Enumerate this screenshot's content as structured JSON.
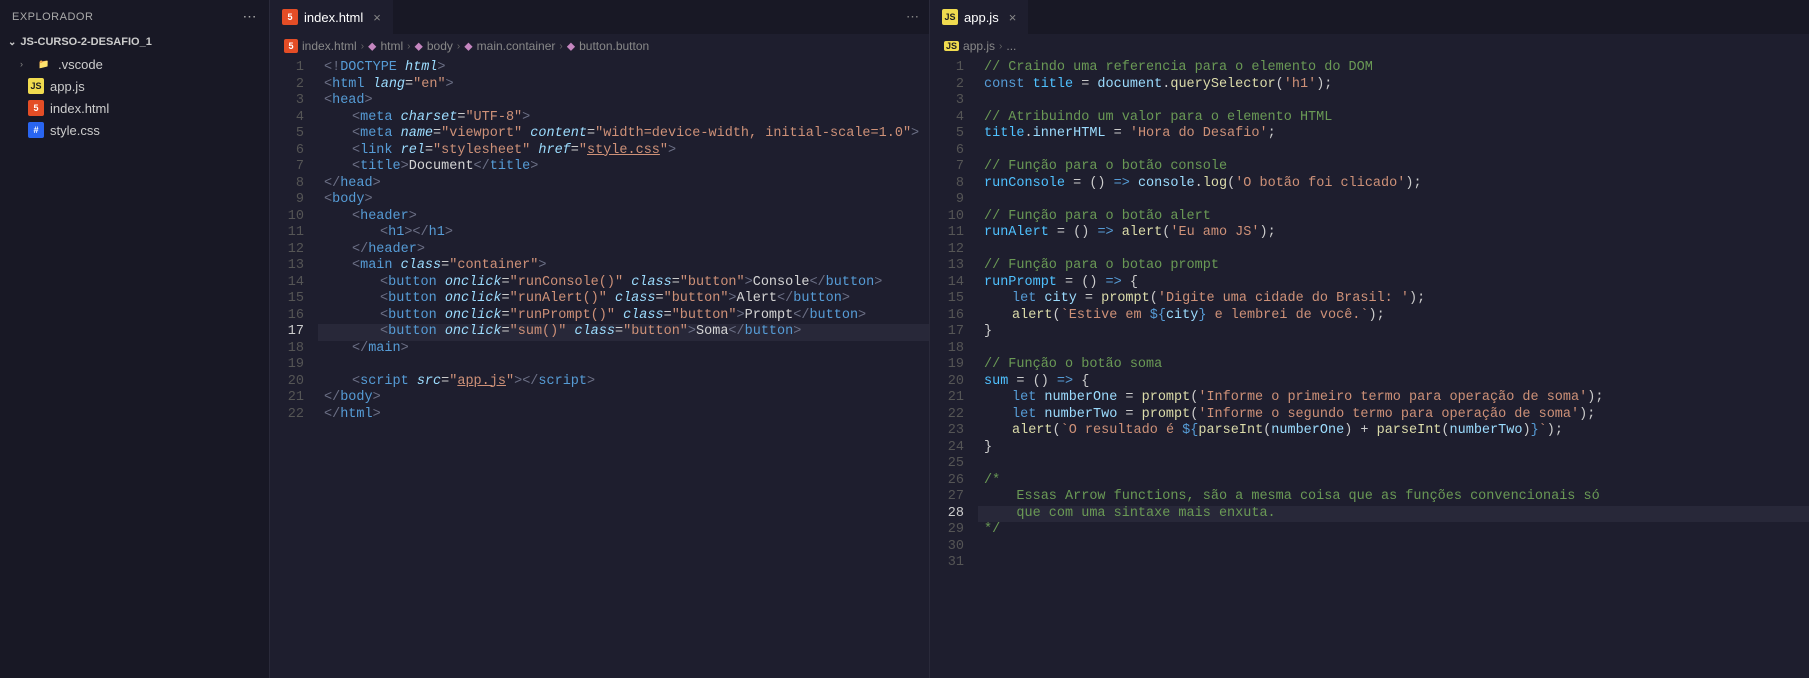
{
  "sidebar": {
    "title": "EXPLORADOR",
    "project": "JS-CURSO-2-DESAFIO_1",
    "items": [
      {
        "name": ".vscode",
        "type": "folder"
      },
      {
        "name": "app.js",
        "type": "js"
      },
      {
        "name": "index.html",
        "type": "html"
      },
      {
        "name": "style.css",
        "type": "css"
      }
    ]
  },
  "tabs_left": {
    "file": "index.html"
  },
  "tabs_right": {
    "file": "app.js"
  },
  "breadcrumb_left": [
    "index.html",
    "html",
    "body",
    "main.container",
    "button.button"
  ],
  "breadcrumb_right": [
    "app.js",
    "..."
  ],
  "code_left_lines": 22,
  "code_right_lines": 31,
  "html_code": {
    "l1": {
      "doctype": "<!",
      "d2": "DOCTYPE ",
      "d3": "html",
      "d4": ">"
    },
    "l2": {
      "o": "<",
      "t": "html ",
      "a": "lang",
      "eq": "=",
      "s": "\"en\"",
      "c": ">"
    },
    "l3": {
      "o": "<",
      "t": "head",
      "c": ">"
    },
    "l4": {
      "o": "<",
      "t": "meta ",
      "a": "charset",
      "eq": "=",
      "s": "\"UTF-8\"",
      "c": ">"
    },
    "l5": {
      "o": "<",
      "t": "meta ",
      "a1": "name",
      "eq": "=",
      "s1": "\"viewport\" ",
      "a2": "content",
      "s2": "\"width=device-width, initial-scale=1.0\"",
      "c": ">"
    },
    "l6": {
      "o": "<",
      "t": "link ",
      "a1": "rel",
      "eq": "=",
      "s1": "\"stylesheet\" ",
      "a2": "href",
      "s2": "\"",
      "href": "style.css",
      "s3": "\"",
      "c": ">"
    },
    "l7": {
      "o": "<",
      "t": "title",
      "c": ">",
      "txt": "Document",
      "o2": "</",
      "t2": "title",
      "c2": ">"
    },
    "l8": {
      "o": "</",
      "t": "head",
      "c": ">"
    },
    "l9": {
      "o": "<",
      "t": "body",
      "c": ">"
    },
    "l10": {
      "o": "<",
      "t": "header",
      "c": ">"
    },
    "l11": {
      "o": "<",
      "t": "h1",
      "c": ">",
      "o2": "</",
      "t2": "h1",
      "c2": ">"
    },
    "l12": {
      "o": "</",
      "t": "header",
      "c": ">"
    },
    "l13": {
      "o": "<",
      "t": "main ",
      "a": "class",
      "eq": "=",
      "s": "\"container\"",
      "c": ">"
    },
    "l14": {
      "o": "<",
      "t": "button ",
      "a1": "onclick",
      "eq": "=",
      "s1": "\"runConsole()\" ",
      "a2": "class",
      "s2": "\"button\"",
      "c": ">",
      "txt": "Console",
      "o2": "</",
      "t2": "button",
      "c2": ">"
    },
    "l15": {
      "o": "<",
      "t": "button ",
      "a1": "onclick",
      "eq": "=",
      "s1": "\"runAlert()\" ",
      "a2": "class",
      "s2": "\"button\"",
      "c": ">",
      "txt": "Alert",
      "o2": "</",
      "t2": "button",
      "c2": ">"
    },
    "l16": {
      "o": "<",
      "t": "button ",
      "a1": "onclick",
      "eq": "=",
      "s1": "\"runPrompt()\" ",
      "a2": "class",
      "s2": "\"button\"",
      "c": ">",
      "txt": "Prompt",
      "o2": "</",
      "t2": "button",
      "c2": ">"
    },
    "l17": {
      "o": "<",
      "t": "button ",
      "a1": "onclick",
      "eq": "=",
      "s1": "\"sum()\" ",
      "a2": "class",
      "s2": "\"button\"",
      "c": ">",
      "txt": "Soma",
      "o2": "</",
      "t2": "button",
      "c2": ">"
    },
    "l18": {
      "o": "</",
      "t": "main",
      "c": ">"
    },
    "l20": {
      "o": "<",
      "t": "script ",
      "a": "src",
      "eq": "=",
      "s": "\"",
      "href": "app.js",
      "s2": "\"",
      "c": ">",
      "o2": "</",
      "t2": "script",
      "c2": ">"
    },
    "l21": {
      "o": "</",
      "t": "body",
      "c": ">"
    },
    "l22": {
      "o": "</",
      "t": "html",
      "c": ">"
    }
  },
  "js_code": {
    "l1": "// Craindo uma referencia para o elemento do DOM",
    "l2": {
      "kw": "const ",
      "v": "title ",
      "eq": "= ",
      "obj": "document",
      "dot": ".",
      "fn": "querySelector",
      "p": "(",
      "s": "'h1'",
      "p2": ");"
    },
    "l4": "// Atribuindo um valor para o elemento HTML",
    "l5": {
      "v": "title",
      "dot": ".",
      "p": "innerHTML ",
      "eq": "= ",
      "s": "'Hora do Desafio'",
      "end": ";"
    },
    "l7": "// Função para o botão console",
    "l8": {
      "v": "runConsole ",
      "eq": "= () ",
      "ar": "=> ",
      "obj": "console",
      "dot": ".",
      "fn": "log",
      "p": "(",
      "s": "'O botão foi clicado'",
      "p2": ");"
    },
    "l10": "// Função para o botão alert",
    "l11": {
      "v": "runAlert ",
      "eq": "= () ",
      "ar": "=> ",
      "fn": "alert",
      "p": "(",
      "s": "'Eu amo JS'",
      "p2": ");"
    },
    "l13": "// Função para o botao prompt",
    "l14": {
      "v": "runPrompt ",
      "eq": "= () ",
      "ar": "=> ",
      "b": "{"
    },
    "l15": {
      "kw": "let ",
      "v": "city ",
      "eq": "= ",
      "fn": "prompt",
      "p": "(",
      "s": "'Digite uma cidade do Brasil: '",
      "p2": ");"
    },
    "l16": {
      "fn": "alert",
      "p": "(",
      "bt": "`Estive em ",
      "d": "${",
      "v": "city",
      "d2": "}",
      "bt2": " e lembrei de você.`",
      "p2": ");"
    },
    "l17": "}",
    "l19": "// Função o botão soma",
    "l20": {
      "v": "sum ",
      "eq": "= () ",
      "ar": "=> ",
      "b": "{"
    },
    "l21": {
      "kw": "let ",
      "v": "numberOne ",
      "eq": "= ",
      "fn": "prompt",
      "p": "(",
      "s": "'Informe o primeiro termo para operação de soma'",
      "p2": ");"
    },
    "l22": {
      "kw": "let ",
      "v": "numberTwo ",
      "eq": "= ",
      "fn": "prompt",
      "p": "(",
      "s": "'Informe o segundo termo para operação de soma'",
      "p2": ");"
    },
    "l23": {
      "fn": "alert",
      "p": "(",
      "bt": "`O resultado é ",
      "d": "${",
      "fn2": "parseInt",
      "p2": "(",
      "v": "numberOne",
      "p3": ") + ",
      "fn3": "parseInt",
      "p4": "(",
      "v2": "numberTwo",
      "p5": ")",
      "d2": "}",
      "bt2": "`",
      "p6": ");"
    },
    "l24": "}",
    "l26": "/*",
    "l27": "    Essas Arrow functions, são a mesma coisa que as funções convencionais só",
    "l28": "    que com uma sintaxe mais enxuta.",
    "l29": "*/"
  }
}
